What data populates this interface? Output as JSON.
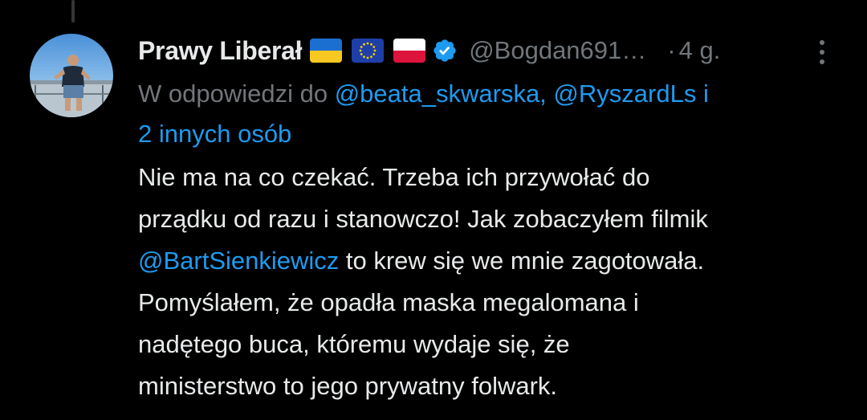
{
  "author": {
    "display_name": "Prawy Liberał",
    "handle": "@Bogdan691…",
    "flags": [
      "ukraine-flag",
      "eu-flag",
      "poland-flag"
    ],
    "verified": true,
    "avatar": "avatar-photo"
  },
  "meta": {
    "separator": "·",
    "time": "4 g."
  },
  "reply": {
    "prefix": "W odpowiedzi do",
    "mention_1": "@beata_skwarska,",
    "mention_2": "@RyszardLs",
    "conjunction": "i",
    "others": "2 innych osób"
  },
  "tweet": {
    "line_1": "Nie ma na co czekać. Trzeba ich przywołać do",
    "line_2": "prządku od razu i stanowczo! Jak zobaczyłem filmik",
    "line_3_mention": "@BartSienkiewicz",
    "line_3_rest": " to krew się we mnie zagotowała.",
    "line_4": "Pomyślałem, że opadła maska megalomana i",
    "line_5": "nadętego buca, któremu wydaje się, że",
    "line_6": "ministerstwo to jego prywatny folwark."
  },
  "colors": {
    "background": "#000000",
    "text": "#e7e9ea",
    "secondary": "#71767b",
    "link": "#1d9bf0",
    "thread_line": "#333639"
  },
  "icons": {
    "more": "more-options-icon",
    "verified": "verified-badge-icon"
  }
}
